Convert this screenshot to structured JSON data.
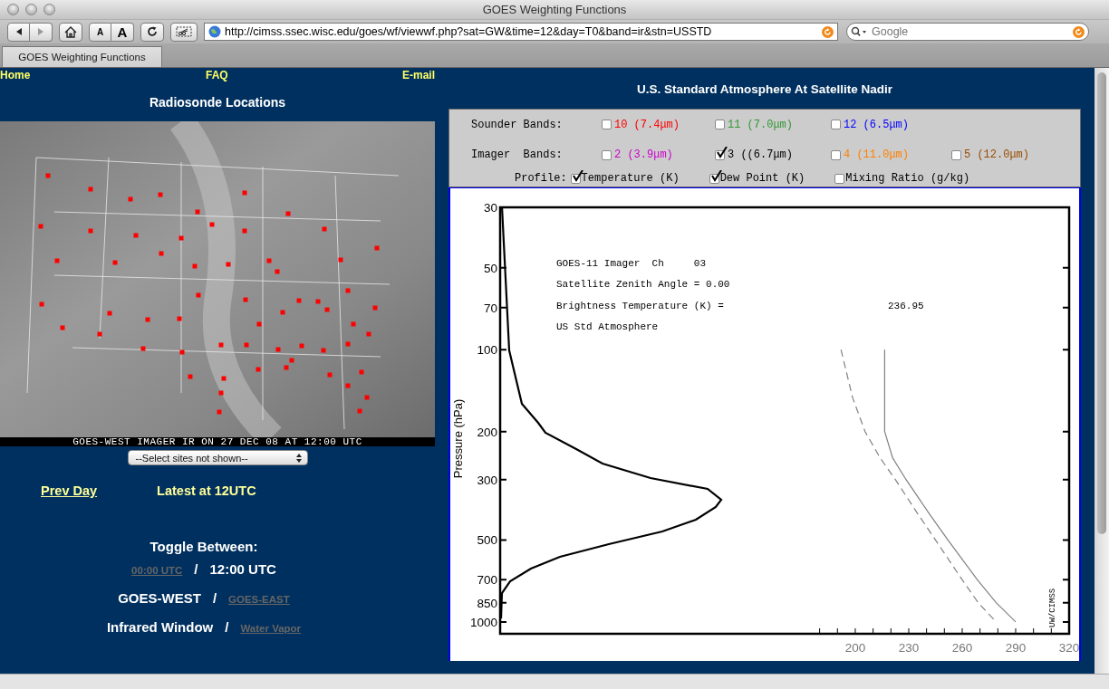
{
  "window": {
    "title": "GOES Weighting Functions"
  },
  "toolbar": {
    "url": "http://cimss.ssec.wisc.edu/goes/wf/viewwf.php?sat=GW&time=12&day=T0&band=ir&stn=USSTD",
    "search": {
      "placeholder": "Google"
    },
    "text_smaller": "A",
    "text_bigger": "A"
  },
  "tabs": [
    {
      "label": "GOES Weighting Functions",
      "selected": true
    }
  ],
  "nav": [
    "Home",
    "FAQ",
    "E-mail"
  ],
  "map_panel": {
    "title": "Radiosonde Locations",
    "caption": "GOES-WEST IMAGER IR ON 27 DEC 08 AT 12:00 UTC",
    "site_select": "--Select sites not shown--",
    "prev_day": "Prev Day",
    "latest": "Latest at 12UTC"
  },
  "toggle_title": "Toggle Between:",
  "toggles": [
    {
      "separator": "/",
      "options": [
        {
          "label": "00:00 UTC",
          "selected": false
        },
        {
          "label": "12:00 UTC",
          "selected": true
        }
      ]
    },
    {
      "separator": "/",
      "options": [
        {
          "label": "GOES-WEST",
          "selected": true
        },
        {
          "label": "GOES-EAST",
          "selected": false
        }
      ]
    },
    {
      "separator": "/",
      "options": [
        {
          "label": "Infrared Window",
          "selected": true
        },
        {
          "label": "Water Vapor",
          "selected": false
        }
      ]
    }
  ],
  "plot_panel": {
    "title": "U.S. Standard Atmosphere At Satellite Nadir",
    "sounder_label": "Sounder Bands:",
    "sounder_bands": [
      {
        "label": "10 (7.4μm)",
        "color": "#ff0000",
        "checked": false
      },
      {
        "label": "11 (7.0μm)",
        "color": "#339933",
        "checked": false
      },
      {
        "label": "12 (6.5μm)",
        "color": "#0000ff",
        "checked": false
      }
    ],
    "imager_label": "Imager  Bands:",
    "imager_bands": [
      {
        "label": "2 (3.9μm)",
        "color": "#cc00cc",
        "checked": false
      },
      {
        "label": "3 ((6.7μm)",
        "color": "#000000",
        "checked": true
      },
      {
        "label": "4 (11.0μm)",
        "color": "#ff8000",
        "checked": false
      },
      {
        "label": "5 (12.0μm)",
        "color": "#994c00",
        "checked": false
      }
    ],
    "profile_label": "Profile:",
    "profile_options": [
      {
        "label": "Temperature (K)",
        "checked": true
      },
      {
        "label": "Dew Point (K)",
        "checked": true
      },
      {
        "label": "Mixing Ratio (g/kg)",
        "checked": false
      }
    ],
    "credit": "UW/CIMSS",
    "plot": {
      "axis_title": "Pressure (hPa)",
      "pressure_labels": [
        "30",
        "50",
        "70",
        "100",
        "200",
        "300",
        "500",
        "700",
        "850",
        "1000"
      ],
      "temperature_labels": [
        "200",
        "230",
        "260",
        "290",
        "320"
      ],
      "notes": [
        "GOES-11 Imager  Ch     03",
        "Satellite Zenith Angle = 0.00",
        "Brightness Temperature (K) =",
        "236.95",
        "US Std Atmosphere"
      ]
    }
  }
}
